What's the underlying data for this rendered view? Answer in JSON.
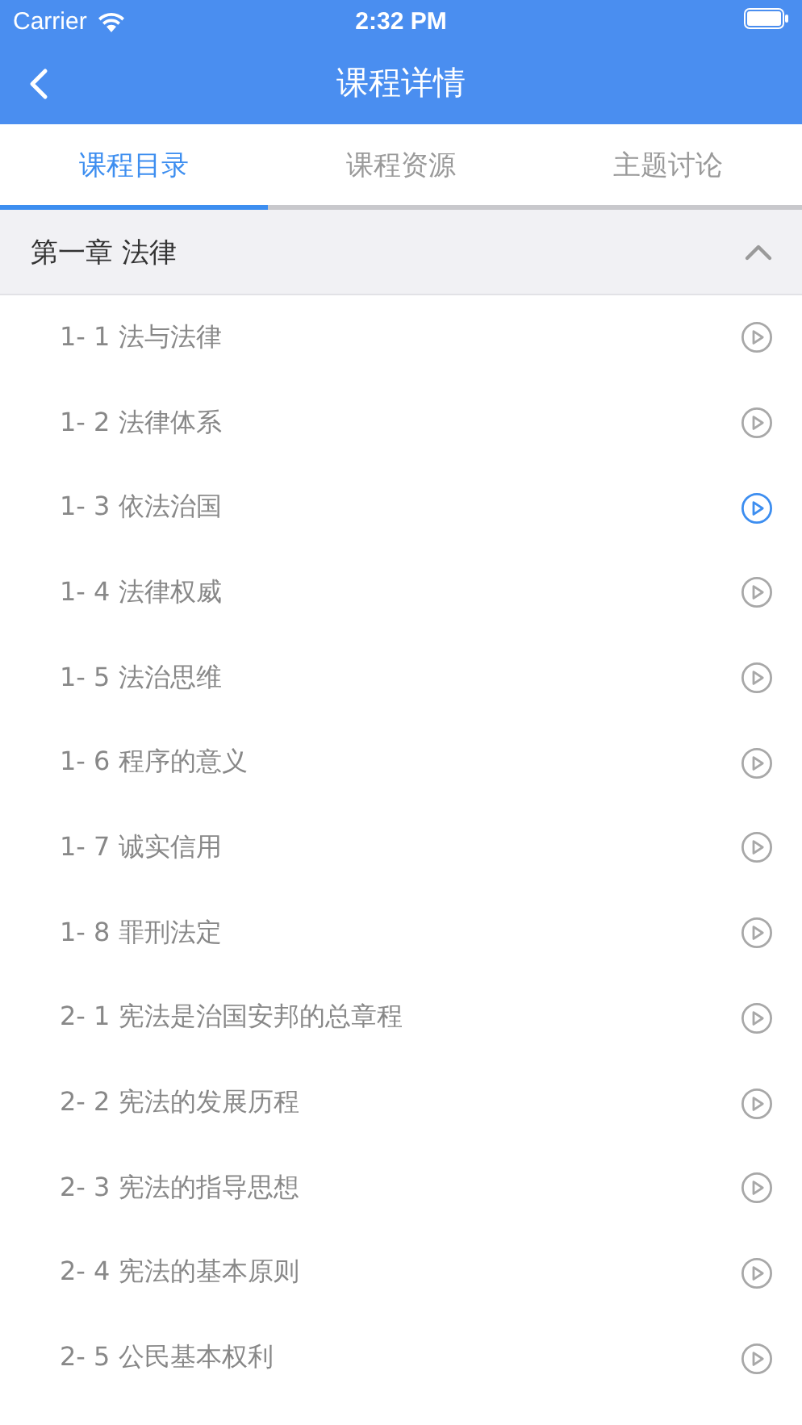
{
  "status_bar": {
    "carrier": "Carrier",
    "time": "2:32 PM"
  },
  "nav": {
    "title": "课程详情"
  },
  "tabs": [
    {
      "label": "课程目录",
      "selected": true
    },
    {
      "label": "课程资源",
      "selected": false
    },
    {
      "label": "主题讨论",
      "selected": false
    }
  ],
  "chapter": {
    "title": "第一章 法律",
    "expanded": true,
    "lessons": [
      {
        "title": "1- 1 法与法律",
        "selected": false
      },
      {
        "title": "1- 2 法律体系",
        "selected": false
      },
      {
        "title": "1- 3 依法治国",
        "selected": true
      },
      {
        "title": "1- 4 法律权威",
        "selected": false
      },
      {
        "title": "1- 5 法治思维",
        "selected": false
      },
      {
        "title": "1- 6 程序的意义",
        "selected": false
      },
      {
        "title": "1- 7 诚实信用",
        "selected": false
      },
      {
        "title": "1- 8 罪刑法定",
        "selected": false
      },
      {
        "title": "2- 1 宪法是治国安邦的总章程",
        "selected": false
      },
      {
        "title": "2- 2 宪法的发展历程",
        "selected": false
      },
      {
        "title": "2- 3 宪法的指导思想",
        "selected": false
      },
      {
        "title": "2- 4 宪法的基本原则",
        "selected": false
      },
      {
        "title": "2- 5 公民基本权利",
        "selected": false
      }
    ]
  }
}
